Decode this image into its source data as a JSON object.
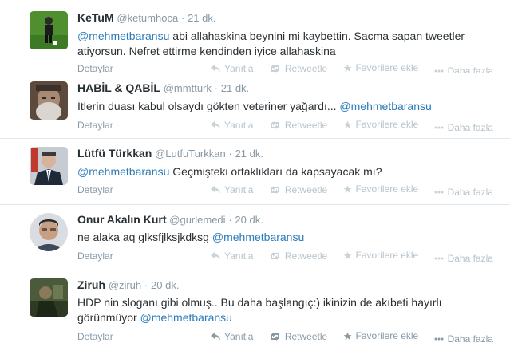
{
  "actions": {
    "reply": "Yanıtla",
    "retweet": "Retweetle",
    "favorite": "Favorilere ekle",
    "more": "Daha fazla"
  },
  "tweets": [
    {
      "fullname": "KeTuM",
      "username": "@ketumhoca",
      "time": "21 dk.",
      "text_line1": "@mehmetbaransu abi allahaskina beynini mi kaybettin. Sacma sapan tweetler",
      "text_line2": "atiyorsun. Nefret ettirme kendinden iyice allahaskina",
      "details": "Detaylar",
      "avatar_icon": "soccer-player-avatar-icon"
    },
    {
      "fullname": "HABİL & QABİL",
      "username": "@mmtturk",
      "time": "21 dk.",
      "text_before": "İtlerin duası kabul olsaydı gökten veteriner yağardı... ",
      "mention": "@mehmetbaransu",
      "details": "Detaylar",
      "avatar_icon": "old-man-avatar-icon"
    },
    {
      "fullname": "Lütfü Türkkan",
      "username": "@LutfuTurkkan",
      "time": "21 dk.",
      "mention": "@mehmetbaransu",
      "text_after": " Geçmişteki ortaklıkları da kapsayacak mı?",
      "details": "Detaylar",
      "avatar_icon": "man-in-suit-avatar-icon"
    },
    {
      "fullname": "Onur Akalın Kurt",
      "username": "@gurlemedi",
      "time": "20 dk.",
      "text_before": "ne alaka aq glksfjlksjkdksg ",
      "mention": "@mehmetbaransu",
      "details": "Detaylar",
      "avatar_icon": "young-man-avatar-icon"
    },
    {
      "fullname": "Ziruh",
      "username": "@ziruh",
      "time": "20 dk.",
      "text_line1": "HDP nin sloganı gibi olmuş.. Bu daha başlangıç:) ikinizin de akıbeti hayırlı",
      "text_line2_before": "görünmüyor ",
      "mention": "@mehmetbaransu",
      "details": "Detaylar",
      "avatar_icon": "cartoon-avatar-icon"
    }
  ],
  "colors": {
    "mention": "#2b7bb9",
    "muted": "#8899a6",
    "divider": "#e1e8ed"
  }
}
